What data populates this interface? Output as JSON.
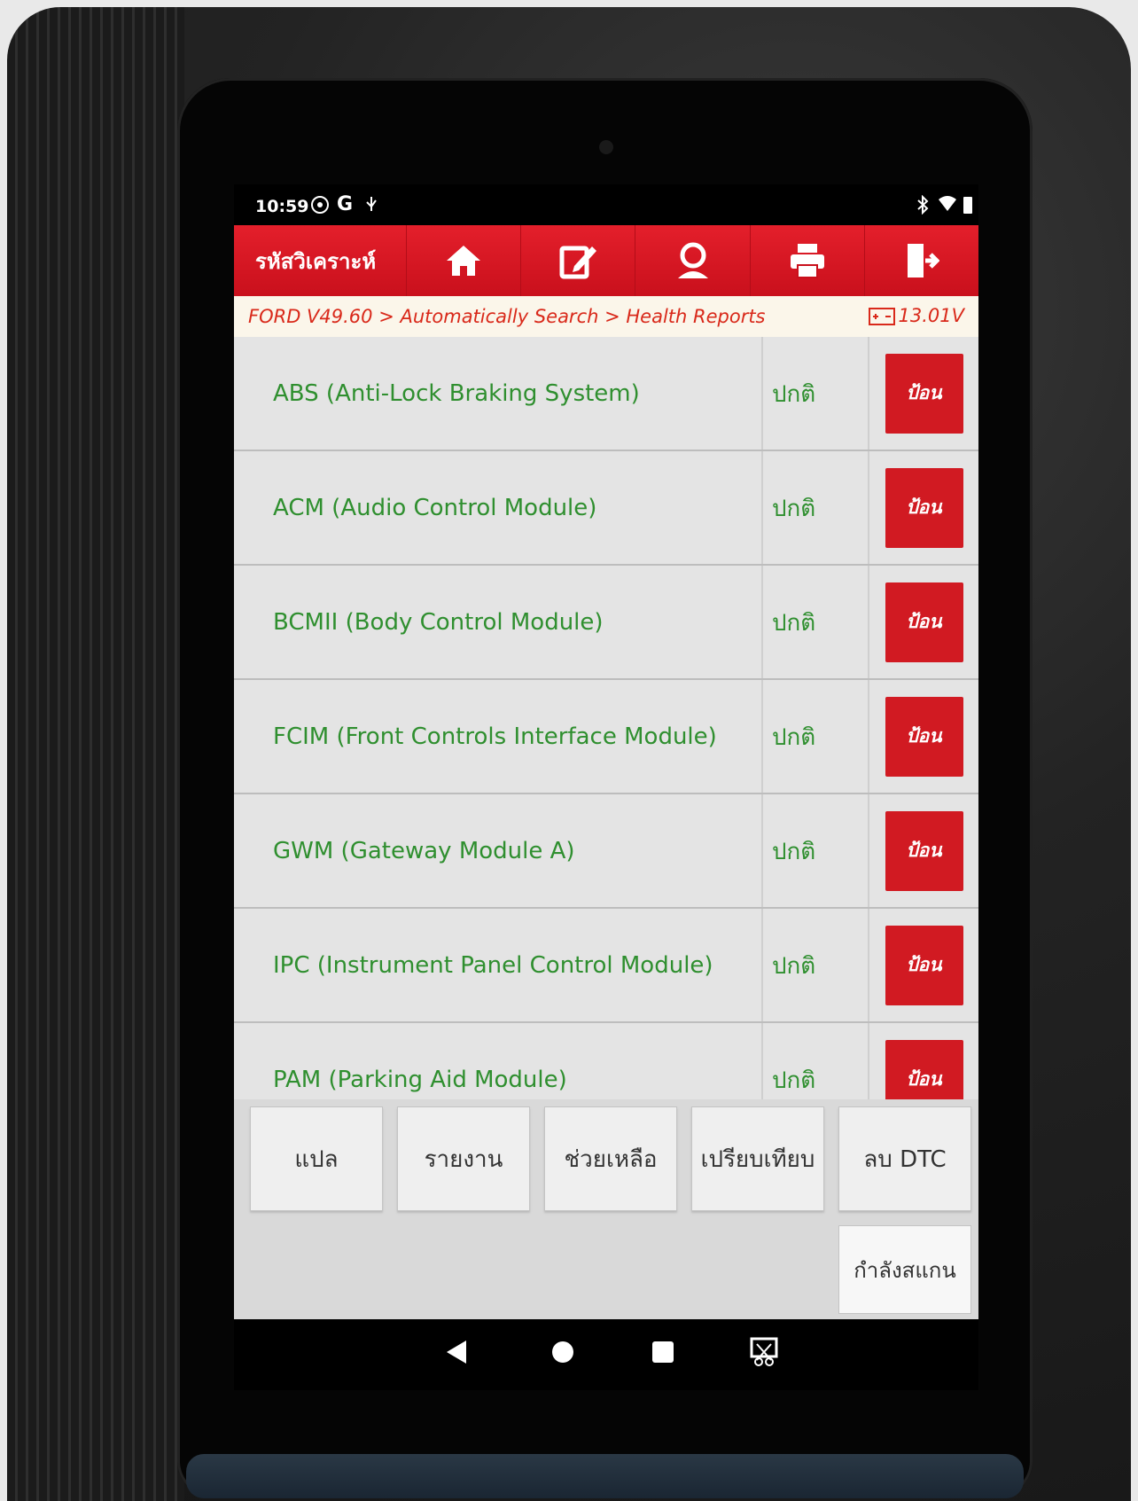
{
  "status_bar": {
    "time": "10:59",
    "left_icons": [
      "settings-icon",
      "google-icon",
      "usb-icon"
    ],
    "right_icons": [
      "bluetooth-icon",
      "wifi-icon",
      "battery-icon"
    ]
  },
  "toolbar": {
    "title": "รหัสวิเคราะห์",
    "buttons": [
      "home-icon",
      "edit-icon",
      "support-icon",
      "print-icon",
      "exit-icon"
    ]
  },
  "breadcrumb": {
    "path": "FORD V49.60 > Automatically Search > Health Reports",
    "voltage": "13.01V"
  },
  "modules": [
    {
      "name": "ABS (Anti-Lock Braking System)",
      "status": "ปกติ",
      "action": "ป้อน"
    },
    {
      "name": "ACM (Audio Control Module)",
      "status": "ปกติ",
      "action": "ป้อน"
    },
    {
      "name": "BCMII (Body Control Module)",
      "status": "ปกติ",
      "action": "ป้อน"
    },
    {
      "name": "FCIM (Front Controls Interface Module)",
      "status": "ปกติ",
      "action": "ป้อน"
    },
    {
      "name": "GWM (Gateway Module A)",
      "status": "ปกติ",
      "action": "ป้อน"
    },
    {
      "name": "IPC (Instrument Panel Control Module)",
      "status": "ปกติ",
      "action": "ป้อน"
    },
    {
      "name": "PAM (Parking Aid Module)",
      "status": "ปกติ",
      "action": "ป้อน"
    }
  ],
  "function_buttons": [
    "แปล",
    "รายงาน",
    "ช่วยเหลือ",
    "เปรียบเทียบ",
    "ลบ DTC"
  ],
  "scan_button": "กำลังสแกน",
  "colors": {
    "accent": "#d11a22",
    "module_text": "#2f8f2f",
    "breadcrumb_text": "#d9291a"
  }
}
